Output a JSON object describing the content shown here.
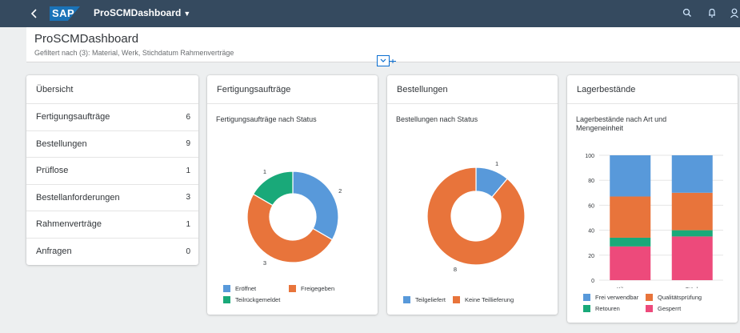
{
  "shell": {
    "app_title": "ProSCMDashboard",
    "logo_text": "SAP",
    "icons": [
      "back-icon",
      "search-icon",
      "bell-icon",
      "user-icon"
    ]
  },
  "header": {
    "title": "ProSCMDashboard",
    "filter_text": "Gefiltert nach (3): Material, Werk, Stichdatum Rahmenverträge"
  },
  "overview": {
    "title": "Übersicht",
    "items": [
      {
        "label": "Fertigungsaufträge",
        "count": "6"
      },
      {
        "label": "Bestellungen",
        "count": "9"
      },
      {
        "label": "Prüflose",
        "count": "1"
      },
      {
        "label": "Bestellanforderungen",
        "count": "3"
      },
      {
        "label": "Rahmenverträge",
        "count": "1"
      },
      {
        "label": "Anfragen",
        "count": "0"
      }
    ]
  },
  "cards": {
    "production": {
      "title": "Fertigungsaufträge",
      "subtitle": "Fertigungsaufträge nach Status"
    },
    "orders": {
      "title": "Bestellungen",
      "subtitle": "Bestellungen nach Status"
    },
    "stock": {
      "title": "Lagerbestände",
      "subtitle": "Lagerbestände nach Art und Mengeneinheit"
    }
  },
  "colors": {
    "blue": "#5899da",
    "orange": "#e8743b",
    "green": "#19a979",
    "pink": "#ed4a7b",
    "shell": "#354a5f"
  },
  "chart_data": [
    {
      "type": "pie",
      "title": "Fertigungsaufträge nach Status",
      "series": [
        {
          "name": "Eröffnet",
          "value": 2,
          "color": "#5899da"
        },
        {
          "name": "Freigegeben",
          "value": 3,
          "color": "#e8743b"
        },
        {
          "name": "Teilrückgemeldet",
          "value": 1,
          "color": "#19a979"
        }
      ]
    },
    {
      "type": "pie",
      "title": "Bestellungen nach Status",
      "series": [
        {
          "name": "Teilgeliefert",
          "value": 1,
          "color": "#5899da"
        },
        {
          "name": "Keine Teillieferung",
          "value": 8,
          "color": "#e8743b"
        }
      ]
    },
    {
      "type": "bar",
      "title": "Lagerbestände nach Art und Mengeneinheit",
      "stacked": true,
      "categories": [
        "Kilogramm",
        "Stück"
      ],
      "ylim": [
        0,
        100
      ],
      "yticks": [
        "0",
        "20",
        "40",
        "60",
        "80",
        "100"
      ],
      "series": [
        {
          "name": "Gesperrt",
          "values": [
            27,
            35
          ],
          "color": "#ed4a7b"
        },
        {
          "name": "Retouren",
          "values": [
            7,
            5
          ],
          "color": "#19a979"
        },
        {
          "name": "Qualitätsprüfung",
          "values": [
            33,
            30
          ],
          "color": "#e8743b"
        },
        {
          "name": "Frei verwendbar",
          "values": [
            33,
            30
          ],
          "color": "#5899da"
        }
      ],
      "legend": [
        "Frei verwendbar",
        "Qualitätsprüfung",
        "Retouren",
        "Gesperrt"
      ]
    }
  ]
}
